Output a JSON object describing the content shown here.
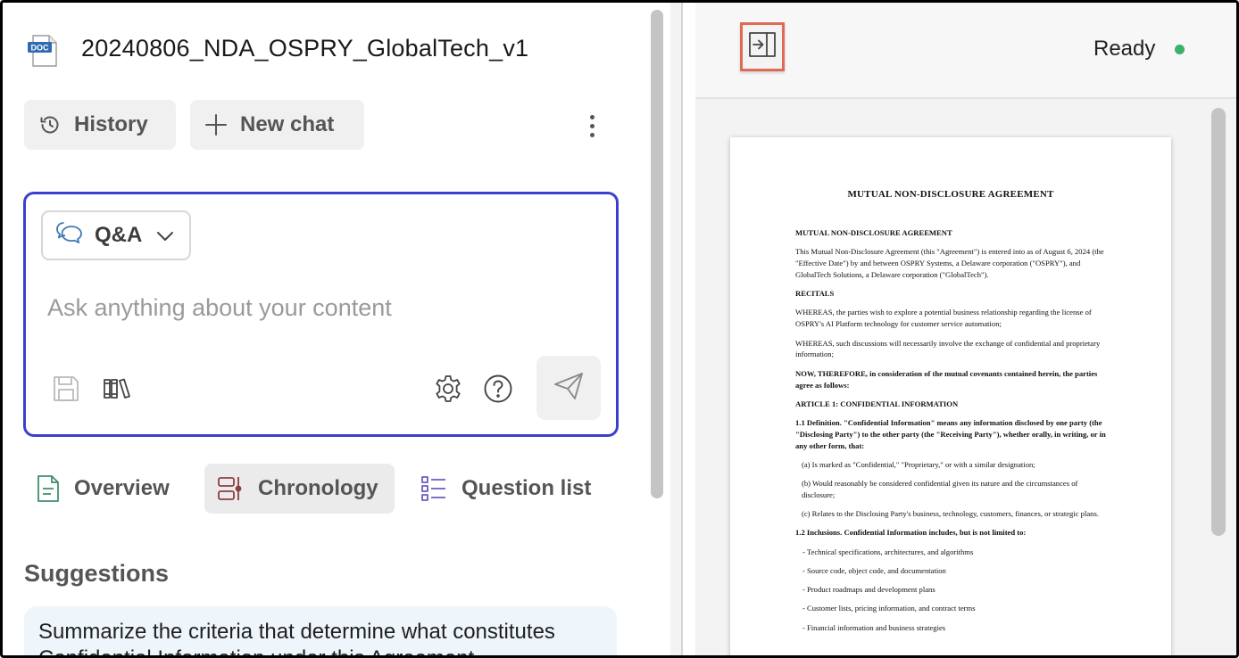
{
  "document": {
    "title": "20240806_NDA_OSPRY_GlobalTech_v1",
    "file_type_badge": "DOC"
  },
  "toolbar": {
    "history_label": "History",
    "new_chat_label": "New chat"
  },
  "chat": {
    "mode_label": "Q&A",
    "input_placeholder": "Ask anything about your content",
    "input_value": ""
  },
  "tabs": [
    {
      "label": "Overview",
      "active": false
    },
    {
      "label": "Chronology",
      "active": true
    },
    {
      "label": "Question list",
      "active": false
    }
  ],
  "suggestions": {
    "title": "Suggestions",
    "items": [
      "Summarize the criteria that determine what constitutes Confidential Information under this Agreement"
    ]
  },
  "viewer": {
    "status": "Ready",
    "status_color": "#3bb16a"
  },
  "page": {
    "title": "MUTUAL NON-DISCLOSURE AGREEMENT",
    "heading": "MUTUAL NON-DISCLOSURE AGREEMENT",
    "intro": "This Mutual Non-Disclosure Agreement (this \"Agreement\") is entered into as of August 6, 2024 (the \"Effective Date\") by and between OSPRY Systems, a Delaware corporation (\"OSPRY\"), and GlobalTech Solutions, a Delaware corporation (\"GlobalTech\").",
    "recitals_heading": "RECITALS",
    "whereas_1": "WHEREAS, the parties wish to explore a potential business relationship regarding the license of OSPRY's AI Platform technology for customer service automation;",
    "whereas_2": "WHEREAS, such discussions will necessarily involve the exchange of confidential and proprietary information;",
    "now_therefore": "NOW, THEREFORE, in consideration of the mutual covenants contained herein, the parties agree as follows:",
    "article_1": "ARTICLE 1: CONFIDENTIAL INFORMATION",
    "def_1_1": "1.1 Definition. \"Confidential Information\" means any information disclosed by one party (the \"Disclosing Party\") to the other party (the \"Receiving Party\"), whether orally, in writing, or in any other form, that:",
    "item_a": "(a) Is marked as \"Confidential,\" \"Proprietary,\" or with a similar designation;",
    "item_b": "(b) Would reasonably be considered confidential given its nature and the circumstances of disclosure;",
    "item_c": "(c) Relates to the Disclosing Party's business, technology, customers, finances, or strategic plans.",
    "inclusions_1_2": "1.2 Inclusions. Confidential Information includes, but is not limited to:",
    "bullets": [
      "- Technical specifications, architectures, and algorithms",
      "- Source code, object code, and documentation",
      "- Product roadmaps and development plans",
      "- Customer lists, pricing information, and contract terms",
      "- Financial information and business strategies"
    ]
  }
}
